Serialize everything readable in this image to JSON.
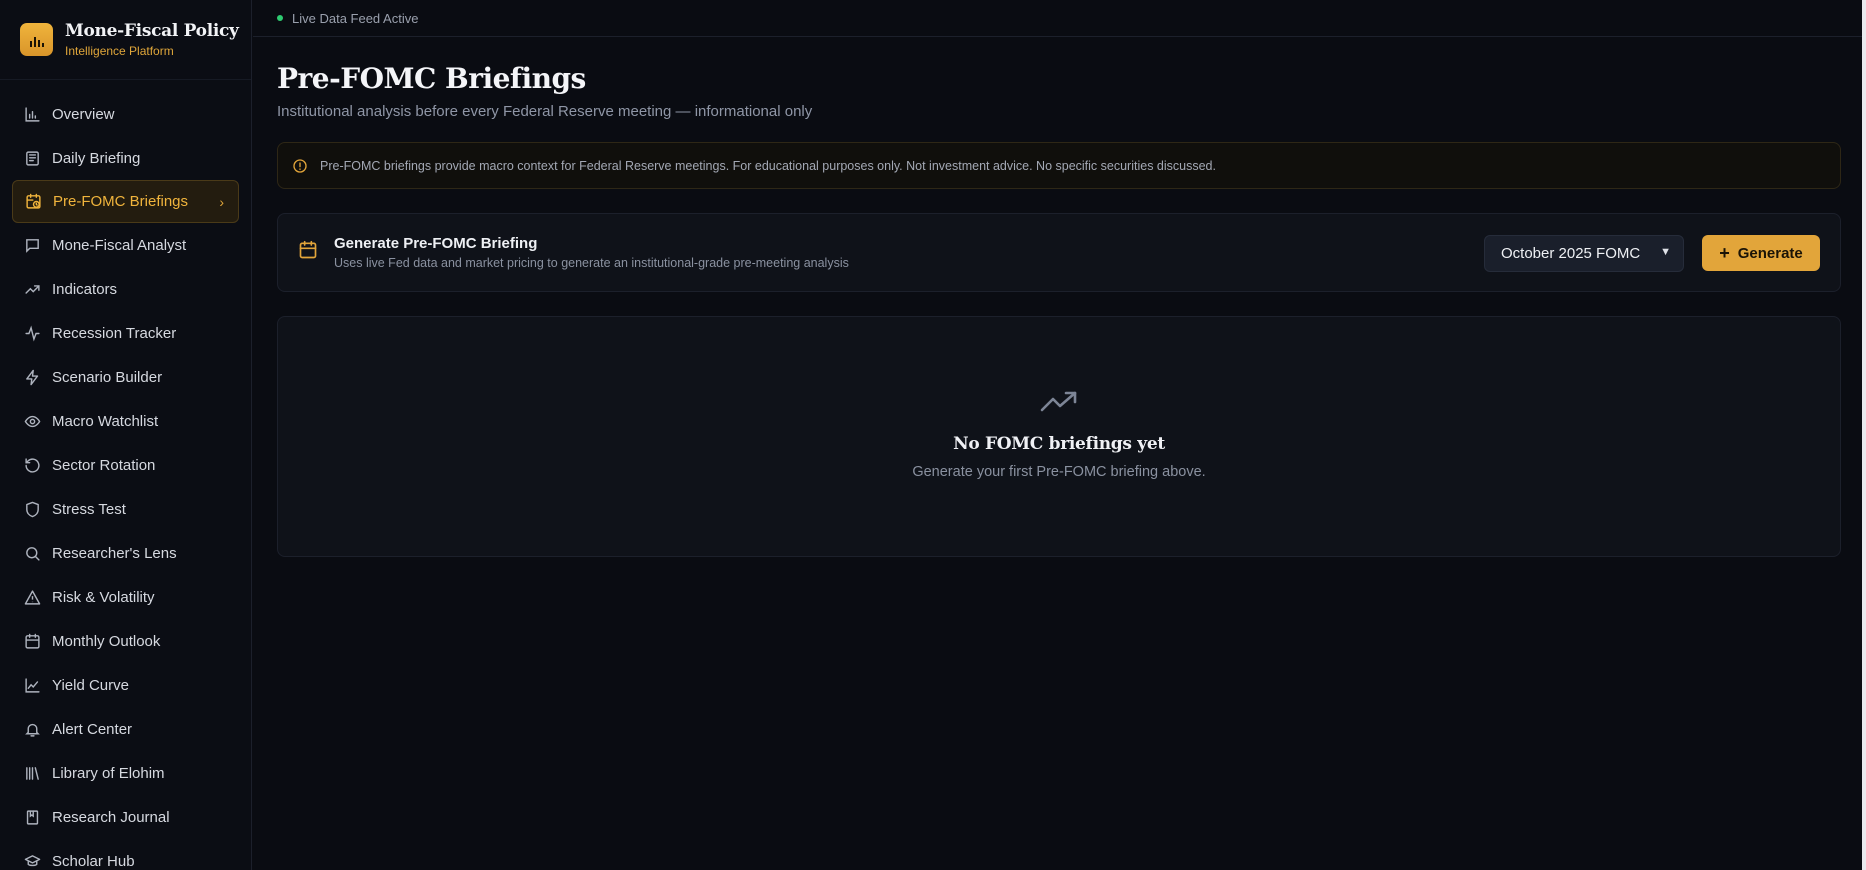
{
  "brand": {
    "title": "Mone-Fiscal Policy",
    "subtitle": "Intelligence Platform"
  },
  "topbar": {
    "status": "Live Data Feed Active"
  },
  "sidebar": {
    "items": [
      {
        "label": "Overview",
        "icon": "bar-chart-icon"
      },
      {
        "label": "Daily Briefing",
        "icon": "newspaper-icon"
      },
      {
        "label": "Pre-FOMC Briefings",
        "icon": "calendar-clock-icon",
        "active": true
      },
      {
        "label": "Mone-Fiscal Analyst",
        "icon": "message-icon"
      },
      {
        "label": "Indicators",
        "icon": "trending-up-icon"
      },
      {
        "label": "Recession Tracker",
        "icon": "activity-icon"
      },
      {
        "label": "Scenario Builder",
        "icon": "zap-icon"
      },
      {
        "label": "Macro Watchlist",
        "icon": "eye-icon"
      },
      {
        "label": "Sector Rotation",
        "icon": "rotate-icon"
      },
      {
        "label": "Stress Test",
        "icon": "shield-icon"
      },
      {
        "label": "Researcher's Lens",
        "icon": "search-icon"
      },
      {
        "label": "Risk & Volatility",
        "icon": "warning-icon"
      },
      {
        "label": "Monthly Outlook",
        "icon": "calendar-icon"
      },
      {
        "label": "Yield Curve",
        "icon": "line-chart-icon"
      },
      {
        "label": "Alert Center",
        "icon": "bell-icon"
      },
      {
        "label": "Library of Elohim",
        "icon": "library-icon"
      },
      {
        "label": "Research Journal",
        "icon": "book-icon"
      },
      {
        "label": "Scholar Hub",
        "icon": "graduation-cap-icon"
      }
    ]
  },
  "main": {
    "title": "Pre-FOMC Briefings",
    "subtitle": "Institutional analysis before every Federal Reserve meeting — informational only",
    "notice": "Pre-FOMC briefings provide macro context for Federal Reserve meetings. For educational purposes only. Not investment advice. No specific securities discussed.",
    "generate": {
      "title": "Generate Pre-FOMC Briefing",
      "description": "Uses live Fed data and market pricing to generate an institutional-grade pre-meeting analysis",
      "selected_meeting": "October 2025 FOMC",
      "button_label": "Generate"
    },
    "empty": {
      "title": "No FOMC briefings yet",
      "description": "Generate your first Pre-FOMC briefing above."
    }
  },
  "colors": {
    "accent": "#e2a53a",
    "background": "#0a0c12",
    "live": "#2ecc71"
  }
}
